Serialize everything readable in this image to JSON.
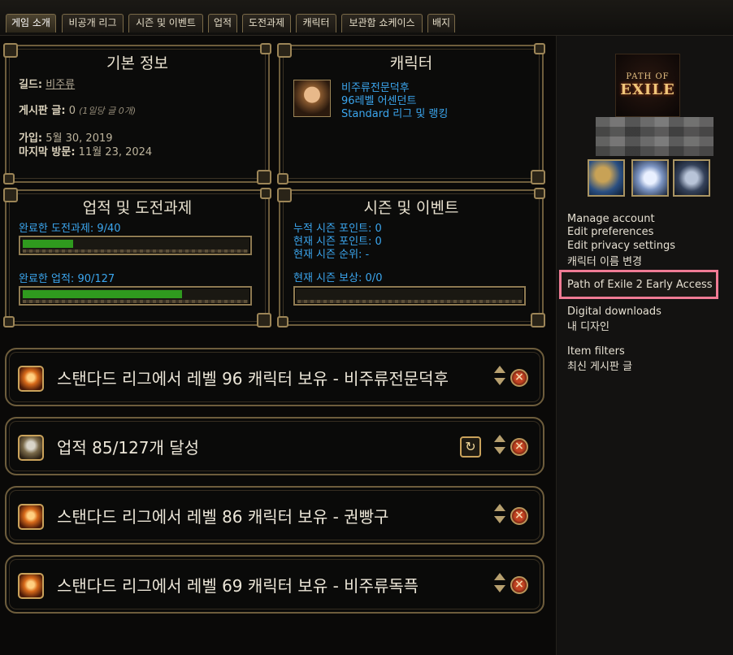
{
  "tabs": [
    "게임 소개",
    "비공개 리그",
    "시즌 및 이벤트",
    "업적",
    "도전과제",
    "캐릭터",
    "보관함 쇼케이스",
    "배지"
  ],
  "basic_info": {
    "title": "기본 정보",
    "guild_label": "길드:",
    "guild_value": "비주류",
    "posts_label": "게시판 글:",
    "posts_value": "0",
    "posts_rate": "(1일당 글 0개)",
    "joined_label": "가입:",
    "joined_value": "5월 30, 2019",
    "last_visit_label": "마지막 방문:",
    "last_visit_value": "11월 23, 2024"
  },
  "character": {
    "title": "캐릭터",
    "name": "비주류전문덕후",
    "level_class": "96레벨 어센던트",
    "league": "Standard 리그 및 랭킹"
  },
  "achievements": {
    "title": "업적 및 도전과제",
    "challenges_label": "완료한 도전과제: 9/40",
    "challenges_progress": 0.225,
    "achievements_label": "완료한 업적: 90/127",
    "achievements_progress": 0.709
  },
  "season": {
    "title": "시즌 및 이벤트",
    "total_points": "누적 시즌 포인트: 0",
    "current_points": "현재 시즌 포인트: 0",
    "current_rank": "현재 시즌 순위: -",
    "current_reward": "현재 시즌 보상: 0/0",
    "reward_progress": 0
  },
  "sidebar": {
    "logo_top": "PATH OF",
    "logo_bottom": "EXILE",
    "links": [
      "Manage account",
      "Edit preferences",
      "Edit privacy settings",
      "캐릭터 이름 변경"
    ],
    "highlighted_link": "Path of Exile 2 Early Access",
    "links2": [
      "Digital downloads",
      "내 디자인"
    ],
    "links3": [
      "Item filters",
      "최신 게시판 글"
    ]
  },
  "feed": [
    {
      "text": "스탠다드 리그에서 레벨 96 캐릭터 보유 - 비주류전문덕후",
      "icon": "character-icon"
    },
    {
      "text": "업적 85/127개 달성",
      "icon": "trophy-icon"
    },
    {
      "text": "스탠다드 리그에서 레벨 86 캐릭터 보유 - 권빵구",
      "icon": "character-icon"
    },
    {
      "text": "스탠다드 리그에서 레벨 69 캐릭터 보유 - 비주류독픅",
      "icon": "character-icon"
    }
  ],
  "colors": {
    "accent_blue": "#3ba6ee",
    "progress_green": "#2f9a1e",
    "highlight_pink": "#f07b94",
    "gold_border": "#6e5d3c"
  }
}
